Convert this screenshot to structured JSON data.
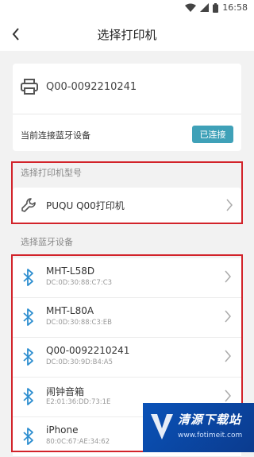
{
  "status_bar": {
    "time": "16:58"
  },
  "header": {
    "title": "选择打印机"
  },
  "current_printer": {
    "name": "Q00-0092210241",
    "connection_label": "当前连接蓝牙设备",
    "connection_status": "已连接"
  },
  "model_section": {
    "label": "选择打印机型号",
    "model_name": "PUQU Q00打印机"
  },
  "bluetooth_section": {
    "label": "选择蓝牙设备",
    "devices": [
      {
        "name": "MHT-L58D",
        "mac": "DC:0D:30:88:C7:C3"
      },
      {
        "name": "MHT-L80A",
        "mac": "DC:0D:30:88:C3:EB"
      },
      {
        "name": "Q00-0092210241",
        "mac": "DC:0D:30:9D:B4:A5"
      },
      {
        "name": "闹钟音箱",
        "mac": "E2:01:36:DD:73:1E"
      },
      {
        "name": "iPhone",
        "mac": "80:0C:67:AE:34:62"
      }
    ]
  },
  "watermark": {
    "name": "清源下载站",
    "url": "www.fotimeit.com"
  },
  "colors": {
    "accent": "#3fa1b8",
    "highlight_box": "#d2232a"
  }
}
